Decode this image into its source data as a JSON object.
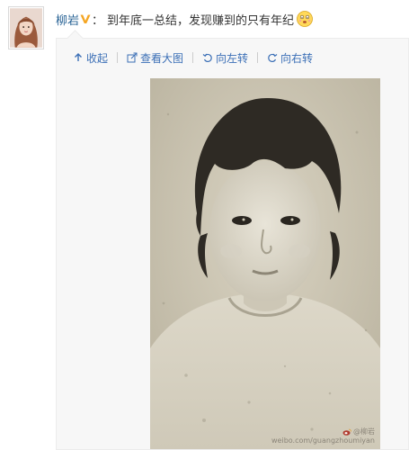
{
  "post": {
    "username": "柳岩",
    "colon": "：",
    "text": "到年底一总结，发现赚到的只有年纪",
    "vip_badge_icon": "vip-v-icon",
    "emoji_icon": "dizzy-face-emoji-icon"
  },
  "toolbar": {
    "collapse_label": "收起",
    "view_large_label": "查看大图",
    "rotate_left_label": "向左转",
    "rotate_right_label": "向右转"
  },
  "photo": {
    "watermark_name": "@柳岩",
    "watermark_url": "weibo.com/guangzhoumiyan"
  },
  "colors": {
    "link": "#3b6fb6",
    "username": "#2a6496",
    "vip_badge": "#f5a623",
    "media_bg": "#f7f7f7"
  }
}
